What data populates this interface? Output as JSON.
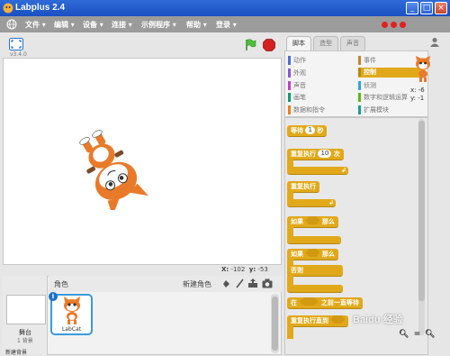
{
  "window": {
    "title": "Labplus 2.4"
  },
  "menu": {
    "items": [
      "文件 ▾",
      "编辑 ▾",
      "设备 ▾",
      "连接 ▾",
      "示例程序 ▾",
      "帮助 ▾",
      "登录 ▾"
    ]
  },
  "stage": {
    "version": "v3.4.0",
    "coords": {
      "x_label": "X:",
      "x_value": "-102",
      "y_label": "y:",
      "y_value": "-53"
    }
  },
  "sprites": {
    "header_label": "角色",
    "new_sprite_label": "新建角色",
    "stage_label": "舞台",
    "stage_backdrops": "1 背景",
    "new_backdrop_label": "新建背景",
    "sprite_name": "LabCat"
  },
  "tabs": [
    "脚本",
    "造型",
    "声音"
  ],
  "categories": {
    "left": [
      "动作",
      "外观",
      "声音",
      "画笔",
      "数据和指令"
    ],
    "right": [
      "事件",
      "控制",
      "侦测",
      "数字和逻辑运算",
      "扩展模块"
    ],
    "left_colors": [
      "#4a6cd4",
      "#8a55d7",
      "#bb42c3",
      "#0e9a6c",
      "#ee7d16"
    ],
    "right_colors": [
      "#c88330",
      "#e1a91a",
      "#2ca5e2",
      "#5cb712",
      "#1a9e94"
    ]
  },
  "sprite_info": {
    "x": "x: -6",
    "y": "y: -1"
  },
  "blocks": {
    "wait_label": "等待",
    "wait_value": "1",
    "wait_unit": "秒",
    "repeat_label": "重复执行",
    "repeat_value": "10",
    "repeat_unit": "次",
    "forever_label": "重复执行",
    "if_label": "如果",
    "then_label": "那么",
    "if2_label": "如果",
    "then2_label": "那么",
    "else_label": "否则",
    "at_label": "在",
    "wait_until_label": "之前一直等待",
    "repeat_until_label": "重复执行直到"
  },
  "watermark": "Baidu 经验"
}
